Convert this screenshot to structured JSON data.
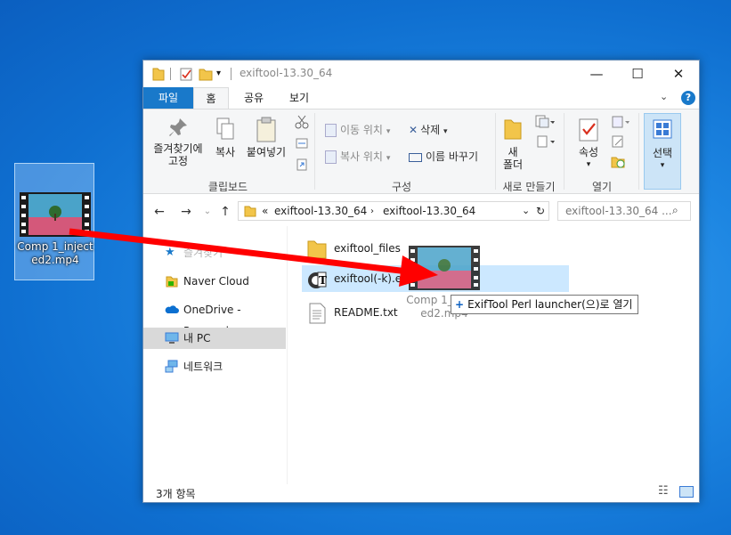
{
  "desktop_icon": {
    "label": "Comp 1_injected2.mp4"
  },
  "window": {
    "title": "exiftool-13.30_64",
    "tabs": {
      "file": "파일",
      "home": "홈",
      "share": "공유",
      "view": "보기"
    },
    "ribbon": {
      "pin": "즐겨찾기에\n고정",
      "copy": "복사",
      "paste": "붙여넣기",
      "clipboard_group": "클립보드",
      "move_to": "이동 위치",
      "copy_to": "복사 위치",
      "delete": "삭제",
      "rename": "이름 바꾸기",
      "organize_group": "구성",
      "new_folder": "새\n폴더",
      "new_group": "새로 만들기",
      "properties": "속성",
      "open_group": "열기",
      "select": "선택"
    },
    "address": {
      "overflow": "«",
      "crumb1": "exiftool-13.30_64",
      "crumb2": "exiftool-13.30_64",
      "search_placeholder": "exiftool-13.30_64 ..."
    },
    "nav": {
      "quick_access": "즐겨찾기",
      "naver_cloud": "Naver Cloud",
      "onedrive": "OneDrive - Personal",
      "this_pc": "내 PC",
      "network": "네트워크"
    },
    "files": [
      {
        "name": "exiftool_files",
        "type": "folder"
      },
      {
        "name": "exiftool(-k).exe",
        "type": "exe"
      },
      {
        "name": "README.txt",
        "type": "txt"
      }
    ],
    "status": {
      "count": "3개 항목"
    }
  },
  "drag": {
    "ghost_label": "Comp 1_injected2.mp4",
    "tooltip": "ExifTool Perl launcher(으)로 열기",
    "tooltip_icon": "plus"
  },
  "colors": {
    "desktop": "#1d86e2",
    "file_tab": "#1979ca",
    "drop_highlight": "#cce8ff",
    "arrow": "#ff0000"
  }
}
